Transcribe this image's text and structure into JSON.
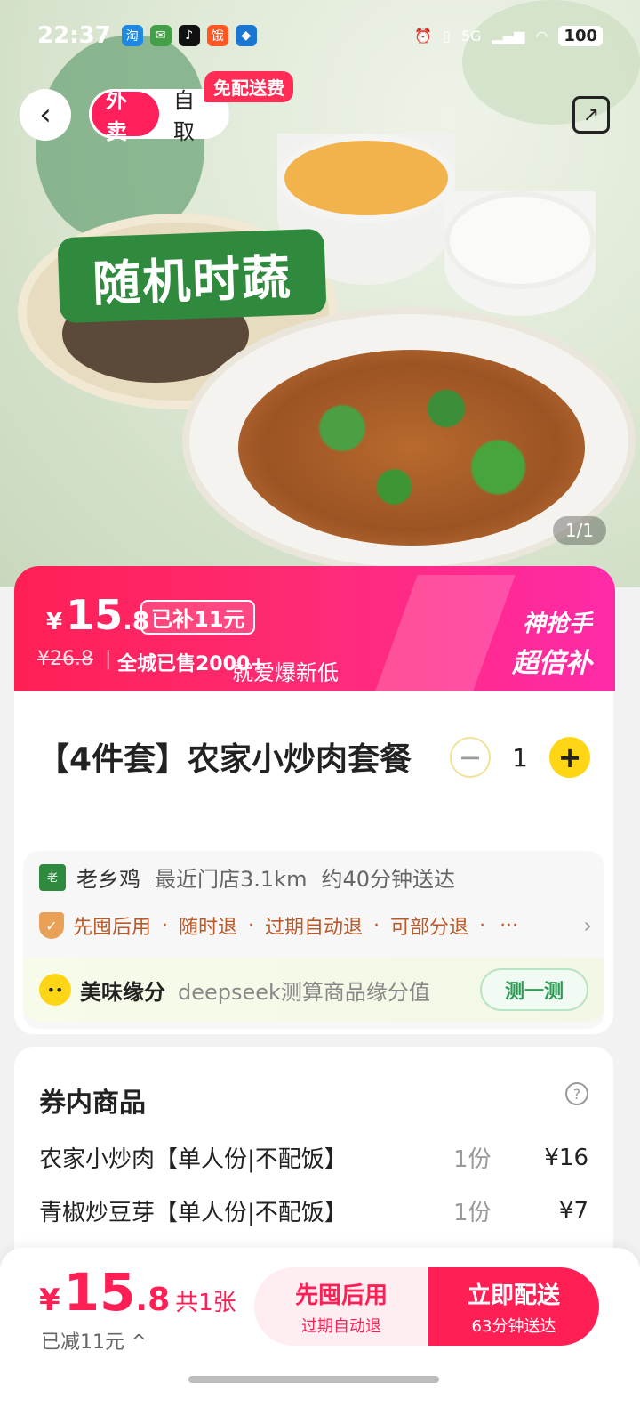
{
  "status_bar": {
    "time": "22:37",
    "battery": "100",
    "network": "5G"
  },
  "header": {
    "back_icon": "back-arrow-icon",
    "modes": [
      "外卖",
      "自取"
    ],
    "free_delivery_tag": "免配送费",
    "share_icon": "share-icon"
  },
  "hero": {
    "badge_text": "随机时蔬",
    "image_counter": "1/1"
  },
  "price_banner": {
    "currency": "¥",
    "price_int": "15",
    "price_dec": ".8",
    "subsidy_label": "已补11元",
    "original_price": "¥26.8",
    "separator": "|",
    "sold_text": "全城已售2000+",
    "slogan": "就爱爆新低",
    "promo_line1": "神抢手",
    "promo_line2": "超倍补",
    "colors": {
      "start": "#ff1f55",
      "end": "#ff2aa8"
    }
  },
  "product": {
    "title": "【4件套】农家小炒肉套餐",
    "quantity": "1",
    "minus_icon": "minus-icon",
    "plus_icon": "plus-icon"
  },
  "store": {
    "name": "老乡鸡",
    "distance": "最近门店3.1km",
    "eta": "约40分钟送达",
    "guarantees": [
      "先囤后用",
      "随时退",
      "过期自动退",
      "可部分退"
    ],
    "dot": "·",
    "more": "···"
  },
  "fate": {
    "title": "美味缘分",
    "desc": "deepseek测算商品缘分值",
    "button": "测一测"
  },
  "items": {
    "title": "券内商品",
    "rows": [
      {
        "name": "农家小炒肉【单人份|不配饭】",
        "qty": "1份",
        "price": "¥16"
      },
      {
        "name": "青椒炒豆芽【单人份|不配饭】",
        "qty": "1份",
        "price": "¥7"
      }
    ]
  },
  "bottom_bar": {
    "currency": "¥",
    "price_int": "15",
    "price_dec": ".8",
    "count": "共1张",
    "reduced": "已减11元 ^",
    "pay_later_label": "先囤后用",
    "pay_later_sub": "过期自动退",
    "deliver_label": "立即配送",
    "deliver_sub": "63分钟送达",
    "accent": "#ff1f55"
  }
}
